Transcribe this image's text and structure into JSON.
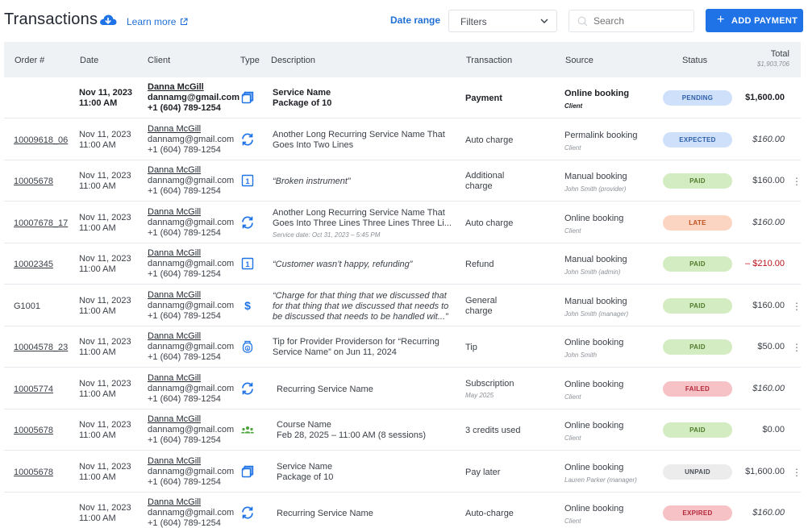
{
  "header": {
    "title": "Transactions",
    "learn_more": "Learn more",
    "date_range": "Date range",
    "filters": "Filters",
    "search_placeholder": "Search",
    "add_payment": "ADD PAYMENT"
  },
  "columns": {
    "order": "Order #",
    "date": "Date",
    "client": "Client",
    "type": "Type",
    "description": "Description",
    "transaction": "Transaction",
    "source": "Source",
    "status": "Status",
    "total": "Total",
    "total_sum": "$1,903,706"
  },
  "rows": [
    {
      "order": "",
      "date": "Nov 11, 2023",
      "time": "11:00 AM",
      "client_name": "Danna McGill",
      "client_email": "dannamg@gmail.com",
      "client_phone": "+1 (604) 789-1254",
      "type_icon": "package-icon",
      "desc1": "Service Name",
      "desc2": "Package of 10",
      "desc3": "",
      "txn": "Payment",
      "txn_sub": "",
      "source": "Online booking",
      "source_sub": "Client",
      "status": "PENDING",
      "total": "$1,600.00"
    },
    {
      "order": "10009618_06",
      "date": "Nov 11, 2023",
      "time": "11:00 AM",
      "client_name": "Danna McGill",
      "client_email": "dannamg@gmail.com",
      "client_phone": "+1 (604) 789-1254",
      "type_icon": "recurring-icon",
      "desc1": "Another Long Recurring Service Name That",
      "desc2": "Goes Into Two Lines",
      "desc3": "",
      "txn": "Auto charge",
      "txn_sub": "",
      "source": "Permalink booking",
      "source_sub": "Client",
      "status": "EXPECTED",
      "total": "$160.00"
    },
    {
      "order": "10005678",
      "date": "Nov 11, 2023",
      "time": "11:00 AM",
      "client_name": "Danna McGill",
      "client_email": "dannamg@gmail.com",
      "client_phone": "+1 (604) 789-1254",
      "type_icon": "single-session-icon",
      "desc1": "“Broken instrument”",
      "desc2": "",
      "desc3": "",
      "txn": "Additional",
      "txn_sub": "charge",
      "source": "Manual booking",
      "source_sub": "John Smith (provider)",
      "status": "PAID",
      "total": "$160.00"
    },
    {
      "order": "10007678_17",
      "date": "Nov 11, 2023",
      "time": "11:00 AM",
      "client_name": "Danna McGill",
      "client_email": "dannamg@gmail.com",
      "client_phone": "+1 (604) 789-1254",
      "type_icon": "recurring-icon",
      "desc1": "Another Long Recurring Service Name That",
      "desc2": "Goes Into Three Lines Three Lines Three Li...",
      "desc3": "Service date: Oct 31, 2023 – 5:45 PM",
      "txn": "Auto charge",
      "txn_sub": "",
      "source": "Online booking",
      "source_sub": "Client",
      "status": "LATE",
      "total": "$160.00"
    },
    {
      "order": "10002345",
      "date": "Nov 11, 2023",
      "time": "11:00 AM",
      "client_name": "Danna McGill",
      "client_email": "dannamg@gmail.com",
      "client_phone": "+1 (604) 789-1254",
      "type_icon": "single-session-icon",
      "desc1": "“Customer wasn’t happy, refunding”",
      "desc2": "",
      "desc3": "",
      "txn": "Refund",
      "txn_sub": "",
      "source": "Manual booking",
      "source_sub": "John Smith (admin)",
      "status": "PAID",
      "total": "– $210.00"
    },
    {
      "order": "G1001",
      "date": "Nov 11, 2023",
      "time": "11:00 AM",
      "client_name": "Danna McGill",
      "client_email": "dannamg@gmail.com",
      "client_phone": "+1 (604) 789-1254",
      "type_icon": "dollar-icon",
      "desc1": "“Charge for that thing that we discussed that",
      "desc2": "for that thing that we discussed that needs to",
      "desc3": "be discussed that needs to be handled wit...”",
      "txn": "General",
      "txn_sub": "charge",
      "source": "Manual booking",
      "source_sub": "John Smith (manager)",
      "status": "PAID",
      "total": "$160.00"
    },
    {
      "order": "10004578_23",
      "date": "Nov 11, 2023",
      "time": "11:00 AM",
      "client_name": "Danna McGill",
      "client_email": "dannamg@gmail.com",
      "client_phone": "+1 (604) 789-1254",
      "type_icon": "tip-jar-icon",
      "desc1": "Tip for Provider Providerson for “Recurring",
      "desc2": "Service Name” on Jun 11, 2024",
      "desc3": "",
      "txn": "Tip",
      "txn_sub": "",
      "source": "Online booking",
      "source_sub": "John Smith",
      "status": "PAID",
      "total": "$50.00"
    },
    {
      "order": "10005774",
      "date": "Nov 11, 2023",
      "time": "11:00 AM",
      "client_name": "Danna McGill",
      "client_email": "dannamg@gmail.com",
      "client_phone": "+1 (604) 789-1254",
      "type_icon": "recurring-icon",
      "desc1": "Recurring Service Name",
      "desc2": "",
      "desc3": "",
      "txn": "Subscription",
      "txn_sub": "May 2025",
      "source": "Online booking",
      "source_sub": "Client",
      "status": "FAILED",
      "total": "$160.00"
    },
    {
      "order": "10005678",
      "date": "Nov 11, 2023",
      "time": "11:00 AM",
      "client_name": "Danna McGill",
      "client_email": "dannamg@gmail.com",
      "client_phone": "+1 (604) 789-1254",
      "type_icon": "group-icon",
      "desc1": "Course Name",
      "desc2": "Feb 28, 2025 – 11:00 AM (8 sessions)",
      "desc3": "",
      "txn": "3 credits used",
      "txn_sub": "",
      "source": "Online booking",
      "source_sub": "Client",
      "status": "PAID",
      "total": "$0.00"
    },
    {
      "order": "10005678",
      "date": "Nov 11, 2023",
      "time": "11:00 AM",
      "client_name": "Danna McGill",
      "client_email": "dannamg@gmail.com",
      "client_phone": "+1 (604) 789-1254",
      "type_icon": "package-icon",
      "desc1": "Service Name",
      "desc2": "Package of 10",
      "desc3": "",
      "txn": "Pay later",
      "txn_sub": "",
      "source": "Online booking",
      "source_sub": "Lauren Parker (manager)",
      "status": "UNPAID",
      "total": "$1,600.00"
    },
    {
      "order": "",
      "date": "Nov 11, 2023",
      "time": "11:00 AM",
      "client_name": "Danna McGill",
      "client_email": "dannamg@gmail.com",
      "client_phone": "+1 (604) 789-1254",
      "type_icon": "recurring-icon",
      "desc1": "Recurring Service Name",
      "desc2": "",
      "desc3": "",
      "txn": "Auto-charge",
      "txn_sub": "",
      "source": "Online booking",
      "source_sub": "Client",
      "status": "EXPIRED",
      "total": "$160.00"
    }
  ],
  "colors": {
    "accent": "#1f73e6",
    "header_bg": "#eff2f5",
    "pending": "#cfe0fb",
    "paid": "#d4ecc1",
    "late": "#fbd5c2",
    "failed": "#f6c2c6",
    "unpaid": "#ececec",
    "negative": "#c0121d"
  }
}
